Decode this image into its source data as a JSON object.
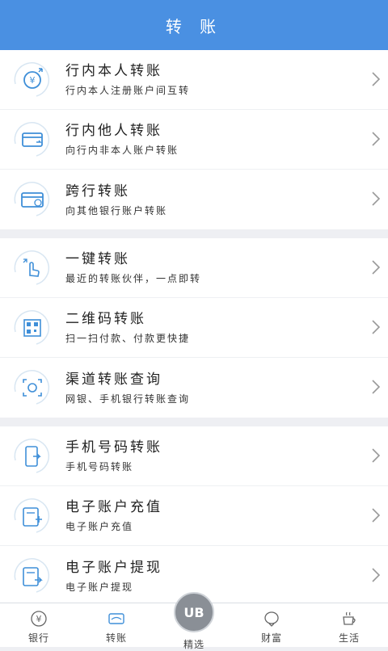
{
  "header": {
    "title": "转 账"
  },
  "groups": [
    {
      "items": [
        {
          "icon": "yen-transfer-icon",
          "title": "行内本人转账",
          "subtitle": "行内本人注册账户间互转"
        },
        {
          "icon": "card-transfer-icon",
          "title": "行内他人转账",
          "subtitle": "向行内非本人账户转账"
        },
        {
          "icon": "interbank-card-icon",
          "title": "跨行转账",
          "subtitle": "向其他银行账户转账"
        }
      ]
    },
    {
      "items": [
        {
          "icon": "one-click-icon",
          "title": "一键转账",
          "subtitle": "最近的转账伙伴，一点即转"
        },
        {
          "icon": "qr-code-icon",
          "title": "二维码转账",
          "subtitle": "扫一扫付款、付款更快捷"
        },
        {
          "icon": "channel-query-icon",
          "title": "渠道转账查询",
          "subtitle": "网银、手机银行转账查询"
        }
      ]
    },
    {
      "items": [
        {
          "icon": "phone-transfer-icon",
          "title": "手机号码转账",
          "subtitle": "手机号码转账"
        },
        {
          "icon": "e-account-topup-icon",
          "title": "电子账户充值",
          "subtitle": "电子账户充值"
        },
        {
          "icon": "e-account-withdraw-icon",
          "title": "电子账户提现",
          "subtitle": "电子账户提现"
        }
      ]
    }
  ],
  "tabs": [
    {
      "icon": "yen-icon",
      "label": "银行"
    },
    {
      "icon": "transfer-tab-icon",
      "label": "转账"
    },
    {
      "icon": "ub-logo",
      "label": "精选",
      "badge": "UB"
    },
    {
      "icon": "wealth-icon",
      "label": "财富"
    },
    {
      "icon": "life-icon",
      "label": "生活"
    }
  ],
  "colors": {
    "header": "#4a90e2",
    "icon_stroke": "#3f8fd8",
    "icon_ring": "#d8e6f2"
  }
}
